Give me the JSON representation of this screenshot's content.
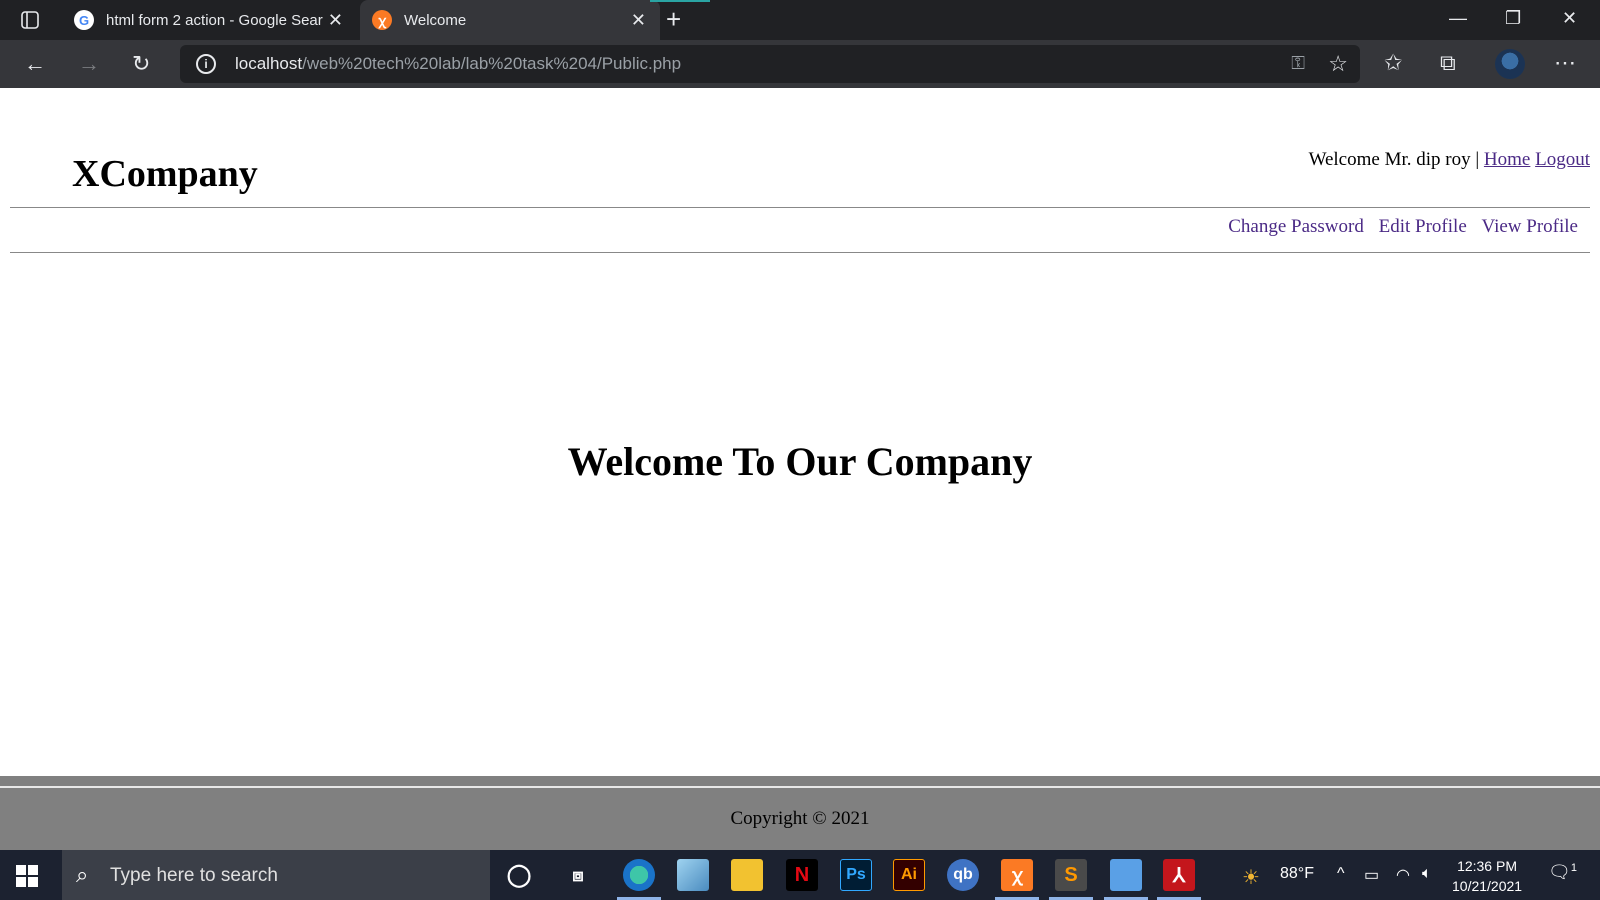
{
  "browser": {
    "tabs": [
      {
        "title": "html form 2 action - Google Sear",
        "favicon": "google-icon",
        "active": false
      },
      {
        "title": "Welcome",
        "favicon": "xampp-icon",
        "active": true
      }
    ],
    "url_host": "localhost",
    "url_path": "/web%20tech%20lab/lab%20task%204/Public.php"
  },
  "page": {
    "brand": "XCompany",
    "welcome_text": "Welcome Mr. dip roy |",
    "home_link": "Home",
    "logout_link": "Logout",
    "menu": [
      "Change Password",
      "Edit Profile",
      "View Profile"
    ],
    "hero_text": "Welcome To Our Company",
    "footer_text": "Copyright © 2021"
  },
  "taskbar": {
    "search_placeholder": "Type here to search",
    "apps": [
      "cortana-icon",
      "task-view-icon",
      "edge-icon",
      "notepad-icon",
      "file-explorer-icon",
      "netflix-icon",
      "photoshop-icon",
      "illustrator-icon",
      "qbittorrent-icon",
      "xampp-icon",
      "sublime-icon",
      "photos-icon",
      "acrobat-icon"
    ],
    "weather": "88°F",
    "time": "12:36 PM",
    "date": "10/21/2021",
    "notification_count": "1"
  },
  "colors": {
    "link": "#4b2a86",
    "footer_bg": "#808080",
    "taskbar_bg": "#1c2230"
  }
}
